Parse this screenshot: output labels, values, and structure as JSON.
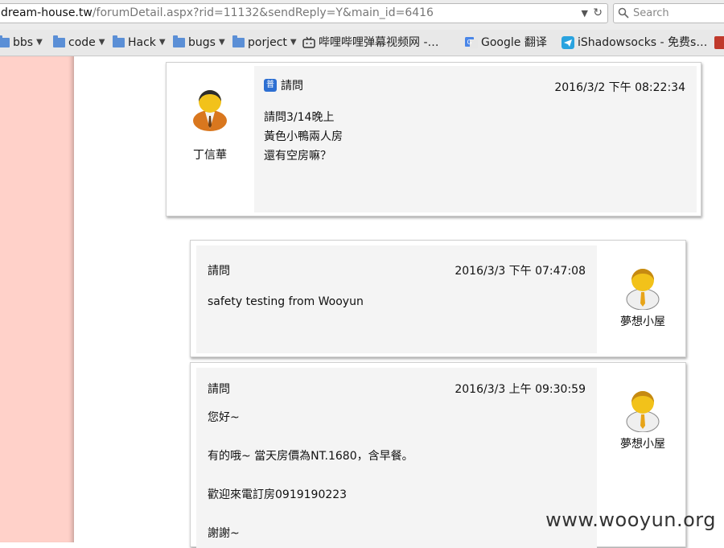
{
  "browser": {
    "url_host": "dream-house.tw",
    "url_path": "/forumDetail.aspx?rid=11132&sendReply=Y&main_id=6416",
    "search_placeholder": "Search"
  },
  "bookmarks": [
    {
      "label": "bbs",
      "icon": "folder-icon",
      "has_arrow": true
    },
    {
      "label": "code",
      "icon": "folder-icon",
      "has_arrow": true
    },
    {
      "label": "Hack",
      "icon": "folder-icon",
      "has_arrow": true
    },
    {
      "label": "bugs",
      "icon": "folder-icon",
      "has_arrow": true
    },
    {
      "label": "porject",
      "icon": "folder-icon",
      "has_arrow": true
    },
    {
      "label": "哔哩哔哩弹幕视频网 -…",
      "icon": "bilibili-icon",
      "has_arrow": false
    },
    {
      "label": "Google 翻译",
      "icon": "google-translate-icon",
      "has_arrow": false
    },
    {
      "label": "iShadowsocks - 免费s…",
      "icon": "telegram-icon",
      "has_arrow": false
    }
  ],
  "posts": [
    {
      "author": "丁信華",
      "title": "請問",
      "tag": "普",
      "time": "2016/3/2 下午 08:22:34",
      "lines": [
        "請問3/14晚上",
        "黃色小鴨兩人房",
        "還有空房嘛？"
      ]
    },
    {
      "author": "夢想小屋",
      "title": "請問",
      "time": "2016/3/3 下午 07:47:08",
      "lines": [
        "safety testing from Wooyun"
      ]
    },
    {
      "author": "夢想小屋",
      "title": "請問",
      "time": "2016/3/3 上午 09:30:59",
      "lines": [
        "您好~",
        "",
        "有的哦~ 當天房價為NT.1680，含早餐。",
        "",
        "歡迎來電訂房0919190223",
        "",
        "謝謝~"
      ]
    }
  ],
  "watermark": "www.wooyun.org",
  "colors": {
    "left_strip": "#ffd1c9",
    "card_inner": "#f4f4f4"
  }
}
